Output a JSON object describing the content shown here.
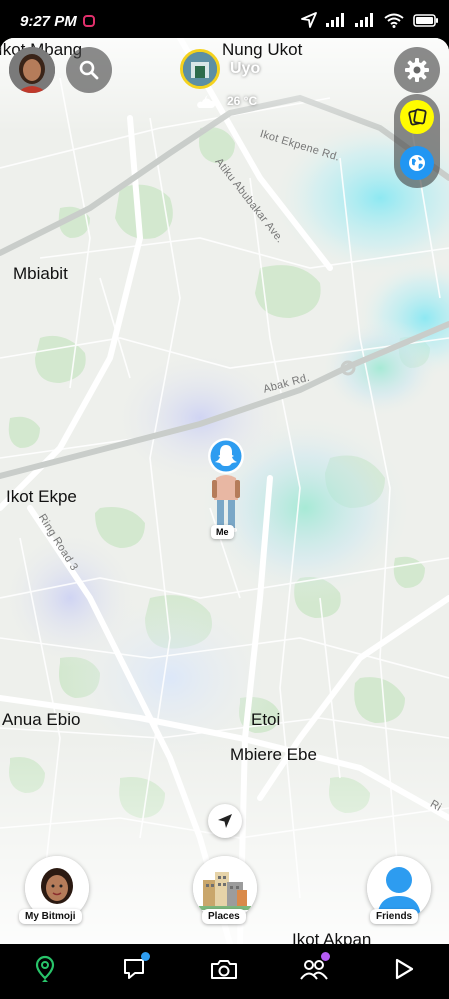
{
  "status_bar": {
    "time": "9:27 PM"
  },
  "header": {
    "city": "Uyo",
    "weather": {
      "temperature": "26 °C",
      "icon": "moon-cloud-icon"
    }
  },
  "map": {
    "places": {
      "nung_ukot": "Nung Ukot",
      "ikot_mbang": "Ikot Mbang",
      "mbiabit": "Mbiabit",
      "ikot_ekpe": "Ikot Ekpe",
      "anua_ebio": "Anua Ebio",
      "etoi": "Etoi",
      "mbiere_ebe": "Mbiere Ebe",
      "ikot_akpan": "Ikot Akpan"
    },
    "roads": {
      "ikot_ekpene": "Ikot Ekpene Rd.",
      "atiku": "Atiku Abubakar Ave.",
      "abak": "Abak Rd.",
      "ring_road": "Ring Road 3",
      "partial_right": "Ri"
    },
    "me_label": "Me"
  },
  "bottom_tiles": {
    "my_bitmoji": "My Bitmoji",
    "places": "Places",
    "friends": "Friends"
  },
  "nav": [
    "map-pin-icon",
    "chat-icon",
    "camera-icon",
    "friends-icon",
    "play-icon"
  ],
  "colors": {
    "snap_yellow": "#FFFC00",
    "globe_blue": "#2196f3",
    "chat_dot": "#2d9cf0",
    "friends_dot": "#b65cf5"
  }
}
